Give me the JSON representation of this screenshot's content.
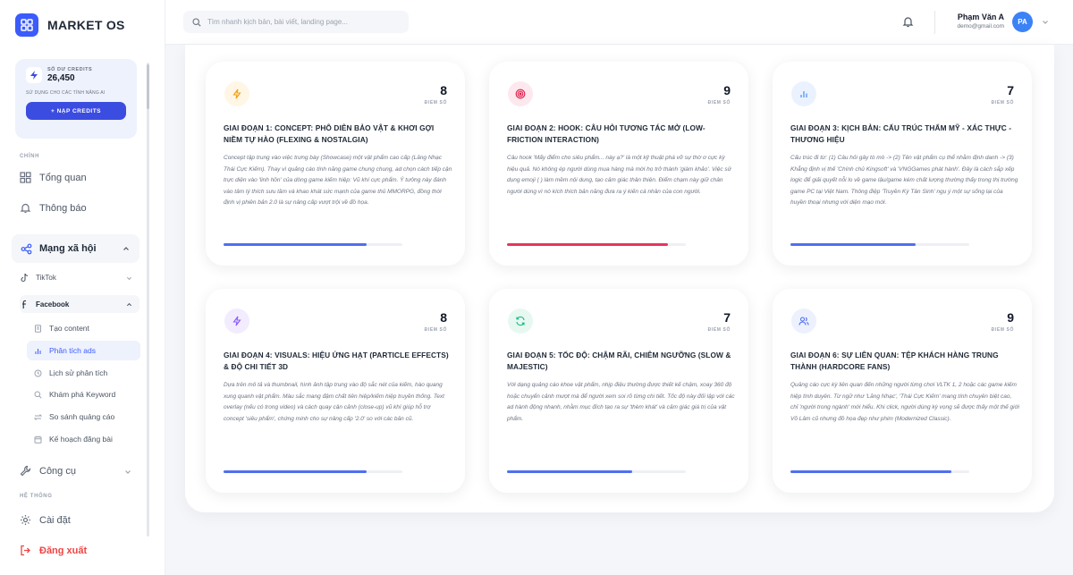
{
  "app": {
    "name": "MARKET OS"
  },
  "credits": {
    "label": "SỐ DƯ CREDITS",
    "value": "26,450",
    "subtitle": "SỬ DỤNG CHO CÁC TÍNH NĂNG AI",
    "button_label": "+ NẠP CREDITS"
  },
  "sidebar": {
    "section_main": "CHÍNH",
    "overview": "Tổng quan",
    "notifications": "Thông báo",
    "social_group": "Mạng xã hội",
    "tiktok": "TikTok",
    "facebook": "Facebook",
    "facebook_items": [
      {
        "label": "Tạo content",
        "icon": "document-icon"
      },
      {
        "label": "Phân tích ads",
        "icon": "bar-chart-icon"
      },
      {
        "label": "Lịch sử phân tích",
        "icon": "history-icon"
      },
      {
        "label": "Khám phá Keyword",
        "icon": "search-icon"
      },
      {
        "label": "So sánh quảng cáo",
        "icon": "compare-icon"
      },
      {
        "label": "Kế hoạch đăng bài",
        "icon": "calendar-icon"
      }
    ],
    "tools": "Công cụ",
    "section_system": "HỆ THỐNG",
    "settings": "Cài đặt",
    "logout": "Đăng xuất"
  },
  "header": {
    "search_placeholder": "Tìm nhanh kịch bản, bài viết, landing page...",
    "user_name": "Phạm Văn A",
    "user_email": "demo@gmail.com",
    "avatar_initials": "PA"
  },
  "score_label": "ĐIỂM SỐ",
  "cards": [
    {
      "score": "8",
      "title": "GIAI ĐOẠN 1: CONCEPT: PHÔ DIỄN BẢO VẬT & KHƠI GỢI NIỀM TỰ HÀO (FLEXING & NOSTALGIA)",
      "description": "Concept tập trung vào việc trưng bày (Showcase) một vật phẩm cao cấp (Lăng Nhạc Thái Cực Kiếm). Thay vì quảng cáo tính năng game chung chung, ad chọn cách tiếp cận trực diện vào 'linh hồn' của dòng game kiếm hiệp: Vũ khí cực phẩm. Ý tưởng này đánh vào tâm lý thích sưu tầm và khao khát sức mạnh của game thủ MMORPG, đồng thời định vị phiên bản 2.0 là sự nâng cấp vượt trội về đồ họa.",
      "progress": 0.8,
      "icon": "lightning-icon",
      "color": "#f59e0b",
      "bg": "#fff6e5",
      "bar": "#4f6ff0"
    },
    {
      "score": "9",
      "title": "GIAI ĐOẠN 2: HOOK: CÂU HỎI TƯƠNG TÁC MỞ (LOW-FRICTION INTERACTION)",
      "description": "Câu hook 'Mấy điểm cho siêu phẩm... này ạ?' là một kỹ thuật phá vỡ sự thờ ơ cực kỳ hiệu quả. Nó không ép người dùng mua hàng mà mời họ trở thành 'giám khảo'. Việc sử dụng emoji (   ) làm mềm nội dung, tạo cảm giác thân thiện. Điểm chạm này giữ chân người dùng vì nó kích thích bản năng đưa ra ý kiến cá nhân của con người.",
      "progress": 0.9,
      "icon": "target-icon",
      "color": "#e11d48",
      "bg": "#fde8ee",
      "bar": "#e8345f"
    },
    {
      "score": "7",
      "title": "GIAI ĐOẠN 3: KỊCH BẢN: CẤU TRÚC THẨM MỸ - XÁC THỰC - THƯƠNG HIỆU",
      "description": "Cấu trúc đi từ: (1) Câu hỏi gây tò mò -> (2) Tên vật phẩm cụ thể nhằm định danh -> (3) Khẳng định vị thế 'Chính chủ Kingsoft' và 'VNGGames phát hành'. Đây là cách sắp xếp logic để giải quyết nỗi lo về game lậu/game kém chất lượng thường thấy trong thị trường game PC tại Việt Nam. Thông điệp 'Truyền Kỳ Tân Sinh' ngụ ý một sự sống lại của huyền thoại nhưng với diện mạo mới.",
      "progress": 0.7,
      "icon": "bar-chart-icon",
      "color": "#3b82f6",
      "bg": "#eaf2ff",
      "bar": "#4f6ff0"
    },
    {
      "score": "8",
      "title": "GIAI ĐOẠN 4: VISUALS: HIỆU ỨNG HẠT (PARTICLE EFFECTS) & ĐỘ CHI TIẾT 3D",
      "description": "Dựa trên mô tả và thumbnail, hình ảnh tập trung vào độ sắc nét của kiếm, hào quang xung quanh vật phẩm. Màu sắc mang đậm chất tiên hiệp/kiếm hiệp truyền thống. Text overlay (nếu có trong video) và cách quay cận cảnh (close-up) vũ khí giúp hỗ trợ concept 'siêu phẩm', chứng minh cho sự nâng cấp '2.0' so với các bản cũ.",
      "progress": 0.8,
      "icon": "lightning-icon",
      "color": "#8b5cf6",
      "bg": "#f2ecfe",
      "bar": "#4f6ff0"
    },
    {
      "score": "7",
      "title": "GIAI ĐOẠN 5: TỐC ĐỘ: CHẬM RÃI, CHIÊM NGƯỠNG (SLOW & MAJESTIC)",
      "description": "Với dạng quảng cáo khoe vật phẩm, nhịp điệu thường được thiết kế chậm, xoay 360 độ hoặc chuyển cảnh mượt mà để người xem soi rõ từng chi tiết. Tốc độ này đối lập với các ad hành động nhanh, nhằm mục đích tạo ra sự 'thèm khát' và cảm giác giá trị của vật phẩm.",
      "progress": 0.7,
      "icon": "refresh-icon",
      "color": "#10b981",
      "bg": "#e7f8f1",
      "bar": "#4f6ff0"
    },
    {
      "score": "9",
      "title": "GIAI ĐOẠN 6: SỰ LIÊN QUAN: TỆP KHÁCH HÀNG TRUNG THÀNH (HARDCORE FANS)",
      "description": "Quảng cáo cực kỳ liên quan đến những người từng chơi VLTK 1, 2 hoặc các game kiếm hiệp tình duyên. Từ ngữ như 'Lăng Nhạc', 'Thái Cực Kiếm' mang tính chuyên biệt cao, chỉ 'người trong ngành' mới hiểu. Khi click, người dùng kỳ vọng sẽ được thấy một thế giới Võ Lâm cũ nhưng đồ họa đẹp như phim (Modernized Classic).",
      "progress": 0.9,
      "icon": "users-icon",
      "color": "#4f6ff0",
      "bg": "#edf1fe",
      "bar": "#4f6ff0"
    }
  ]
}
